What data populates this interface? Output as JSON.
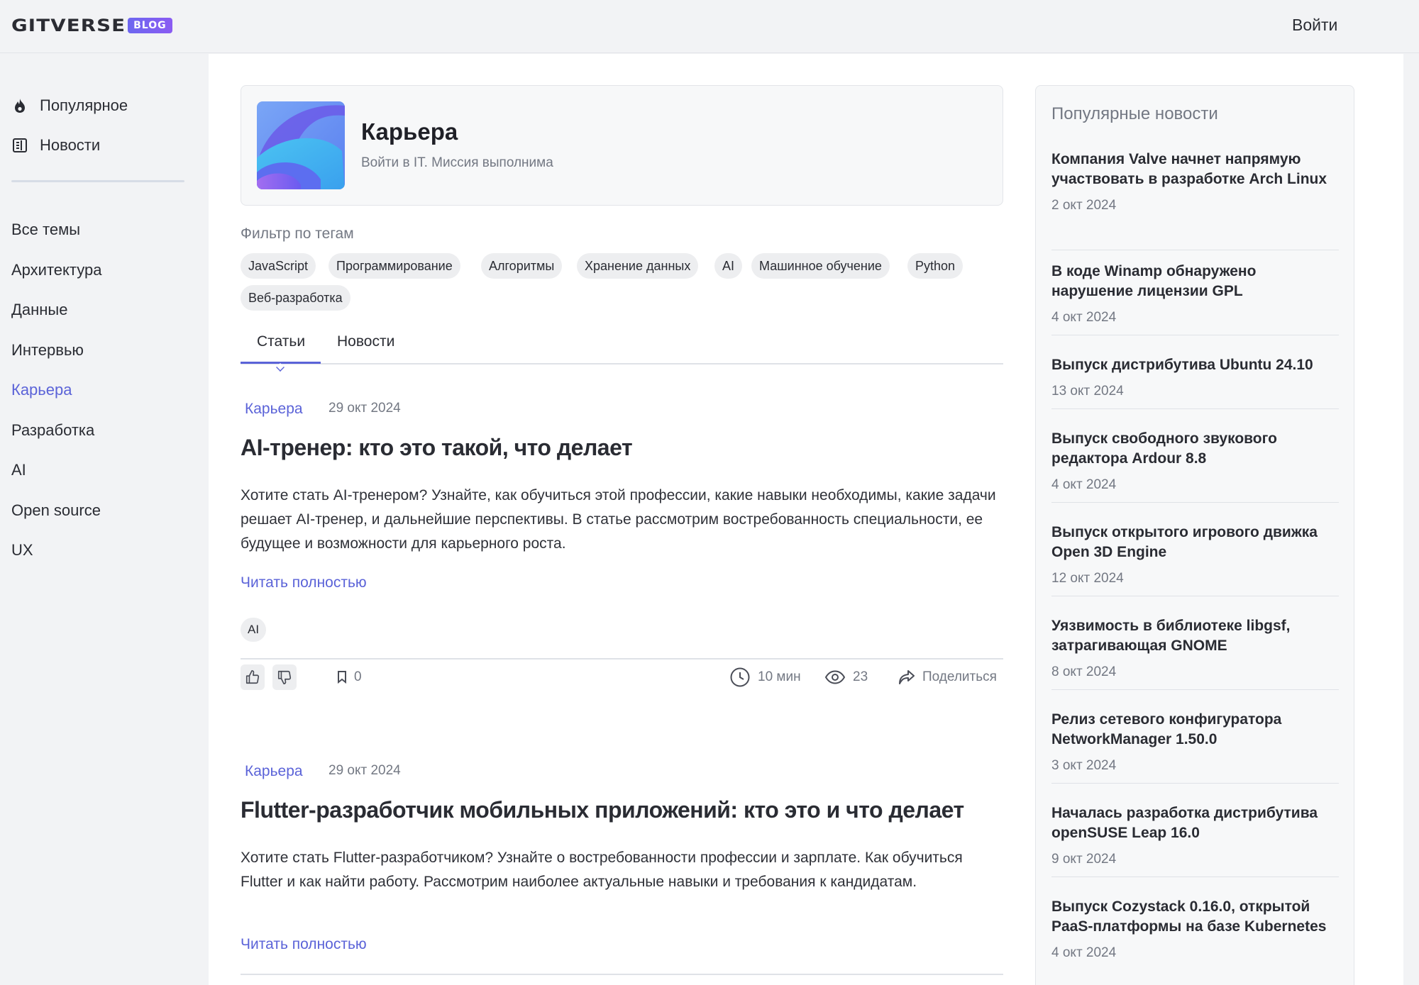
{
  "header": {
    "logo_word": "GITVERSE",
    "logo_badge": "BLOG",
    "login_label": "Войти"
  },
  "sidebar": {
    "top_items": [
      {
        "label": "Популярное",
        "icon": "fire-icon"
      },
      {
        "label": "Новости",
        "icon": "newspaper-icon"
      }
    ],
    "topics": [
      "Все темы",
      "Архитектура",
      "Данные",
      "Интервью",
      "Карьера",
      "Разработка",
      "AI",
      "Open source",
      "UX"
    ],
    "active_topic": "Карьера",
    "accent_color": "#5b63d8"
  },
  "category": {
    "title": "Карьера",
    "subtitle": "Войти в IT. Миссия выполнима"
  },
  "filter": {
    "label": "Фильтр по тегам",
    "tags": [
      "JavaScript",
      "Программирование",
      "Алгоритмы",
      "Хранение данных",
      "AI",
      "Машинное обучение",
      "Python",
      "Веб-разработка"
    ]
  },
  "tabs": [
    {
      "label": "Статьи",
      "active": true
    },
    {
      "label": "Новости",
      "active": false
    }
  ],
  "articles": [
    {
      "category": "Карьера",
      "date": "29 окт 2024",
      "title": "AI-тренер: кто это такой, что делает",
      "text": "Хотите стать AI-тренером? Узнайте, как обучиться этой профессии, какие навыки необходимы, какие задачи решает AI-тренер, и дальнейшие перспективы. В статье рассмотрим востребованность специальности, ее будущее и возможности для карьерного роста.",
      "read_more": "Читать полностью",
      "tag": "AI",
      "bookmarks": "0",
      "read_time": "10 мин",
      "views": "23",
      "share_label": "Поделиться"
    },
    {
      "category": "Карьера",
      "date": "29 окт 2024",
      "title": "Flutter-разработчик мобильных приложений: кто это и что делает",
      "text": "Хотите стать Flutter-разработчиком? Узнайте о востребованности профессии и зарплате. Как обучиться Flutter и как найти работу. Рассмотрим наиболее актуальные навыки и требования к кандидатам.",
      "read_more": "Читать полностью"
    }
  ],
  "popular_news": {
    "title": "Популярные новости",
    "items": [
      {
        "title": "Компания Valve начнет напрямую участвовать в разработке Arch Linux",
        "date": "2 окт 2024"
      },
      {
        "title": "В коде Winamp обнаружено нарушение лицензии GPL",
        "date": "4 окт 2024"
      },
      {
        "title": "Выпуск дистрибутива Ubuntu 24.10",
        "date": "13 окт 2024"
      },
      {
        "title": "Выпуск свободного звукового редактора Ardour 8.8",
        "date": "4 окт 2024"
      },
      {
        "title": "Выпуск открытого игрового движка Open 3D Engine",
        "date": "12 окт 2024"
      },
      {
        "title": "Уязвимость в библиотеке libgsf, затрагивающая GNOME",
        "date": "8 окт 2024"
      },
      {
        "title": "Релиз сетевого конфигуратора NetworkManager 1.50.0",
        "date": "3 окт 2024"
      },
      {
        "title": "Началась разработка дистрибутива openSUSE Leap 16.0",
        "date": "9 окт 2024"
      },
      {
        "title": "Выпуск Cozystack 0.16.0, открытой PaaS-платформы на базе Kubernetes",
        "date": "4 окт 2024"
      }
    ]
  }
}
